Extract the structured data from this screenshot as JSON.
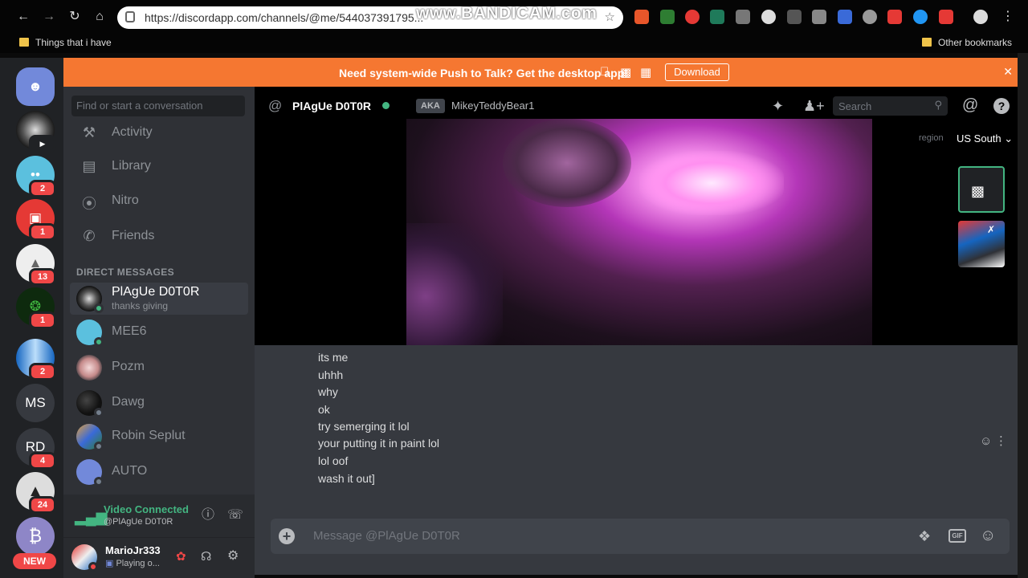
{
  "browser": {
    "url": "https://discordapp.com/channels/@me/544037391795...",
    "watermark": "www.BANDICAM.com",
    "bookmarks": [
      {
        "label": "Things that i have"
      },
      {
        "label": "Other bookmarks"
      }
    ]
  },
  "banner": {
    "text": "Need system-wide Push to Talk? Get the desktop app!",
    "download_label": "Download"
  },
  "guilds": {
    "items": [
      {
        "label": "",
        "badge": ""
      },
      {
        "label": "",
        "badge": ""
      },
      {
        "label": "",
        "badge": "2"
      },
      {
        "label": "",
        "badge": "1"
      },
      {
        "label": "",
        "badge": "13"
      },
      {
        "label": "",
        "badge": "1"
      },
      {
        "label": "",
        "badge": "2"
      },
      {
        "label": "MS",
        "badge": ""
      },
      {
        "label": "RD",
        "badge": "4"
      },
      {
        "label": "",
        "badge": "24"
      },
      {
        "label": "",
        "badge": ""
      }
    ],
    "new_badge": "NEW"
  },
  "channels": {
    "search_placeholder": "Find or start a conversation",
    "nav": [
      {
        "label": "Activity"
      },
      {
        "label": "Library"
      },
      {
        "label": "Nitro"
      },
      {
        "label": "Friends"
      }
    ],
    "dm_header": "DIRECT MESSAGES",
    "dms": [
      {
        "name": "PlAgUe D0T0R",
        "sub": "thanks giving"
      },
      {
        "name": "MEE6",
        "sub": ""
      },
      {
        "name": "Pozm",
        "sub": ""
      },
      {
        "name": "Dawg",
        "sub": ""
      },
      {
        "name": "Robin Seplut",
        "sub": ""
      },
      {
        "name": "AUTO",
        "sub": ""
      }
    ]
  },
  "voice": {
    "status": "Video Connected",
    "channel": "@PlAgUe D0T0R"
  },
  "user": {
    "name": "MarioJr333",
    "status": "Playing o..."
  },
  "header": {
    "title": "PlAgUe D0T0R",
    "aka_tag": "AKA",
    "aka_name": "MikeyTeddyBear1",
    "search_placeholder": "Search",
    "region_label": "region",
    "region_value": "US South"
  },
  "messages": [
    "its me",
    "uhhh",
    "why",
    "ok",
    "try semerging it lol",
    "your putting it in paint lol",
    "lol oof",
    "wash it out]"
  ],
  "composer": {
    "placeholder": "Message @PlAgUe D0T0R",
    "gif_label": "GIF"
  },
  "colors": {
    "banner": "#f57731",
    "online": "#43b581",
    "badge": "#f04747",
    "video_connected": "#43b581",
    "blurple": "#7289da"
  }
}
